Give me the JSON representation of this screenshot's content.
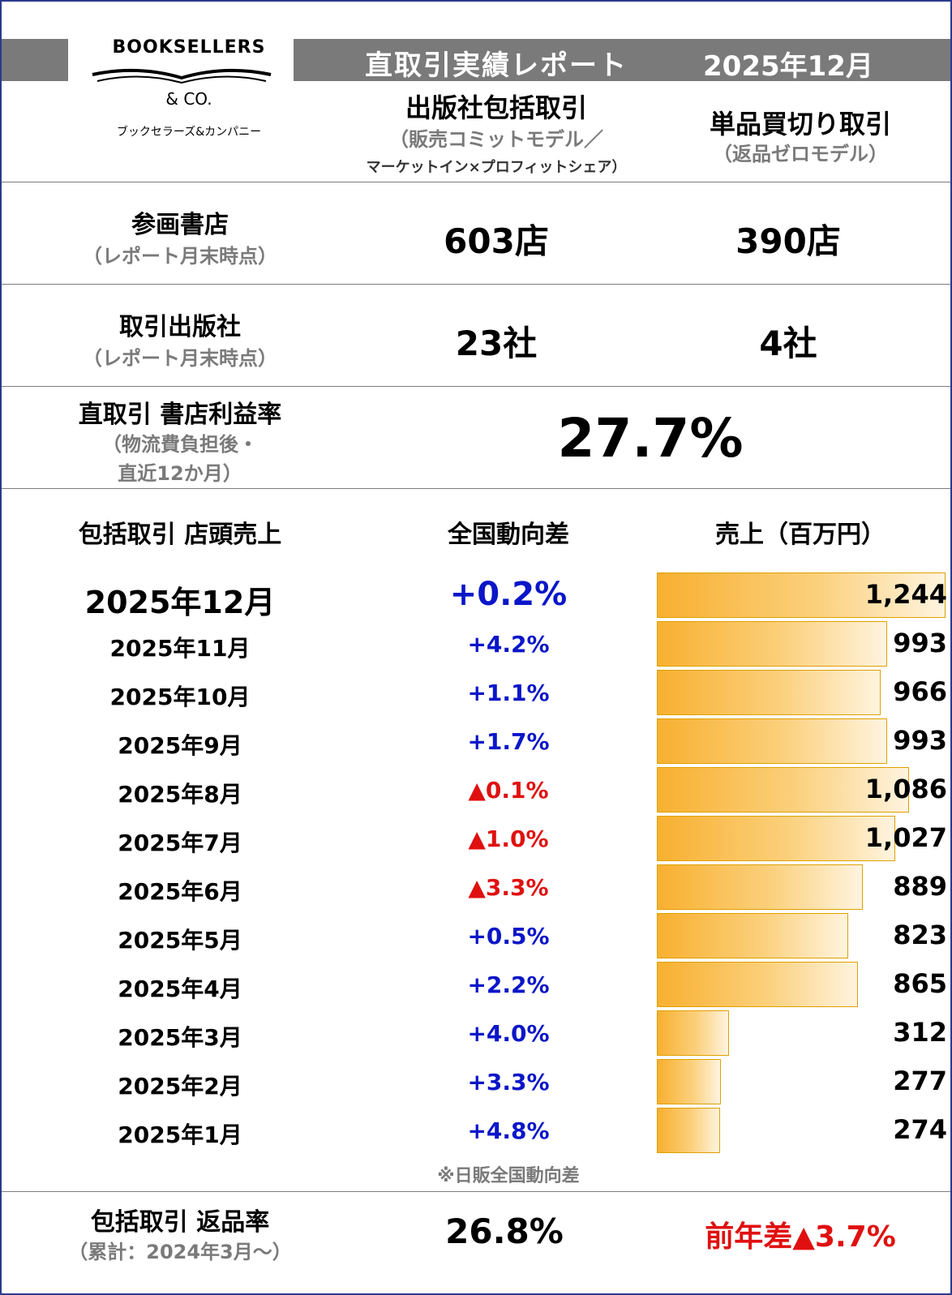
{
  "header": {
    "title": "直取引実績レポート",
    "period": "2025年12月"
  },
  "logo": {
    "name": "BOOKSELLERS",
    "co": "& CO.",
    "kana": "ブックセラーズ&カンパニー"
  },
  "columns": {
    "bundle": {
      "title": "出版社包括取引",
      "sub1": "（販売コミットモデル／",
      "sub2": "マーケットイン×プロフィットシェア）"
    },
    "single": {
      "title": "単品買切り取引",
      "sub": "（返品ゼロモデル）"
    }
  },
  "stores": {
    "label": "参画書店",
    "note": "（レポート月末時点）",
    "bundle": "603店",
    "single": "390店"
  },
  "publishers": {
    "label": "取引出版社",
    "note": "（レポート月末時点）",
    "bundle": "23社",
    "single": "4社"
  },
  "margin": {
    "label": "直取引 書店利益率",
    "note1": "（物流費負担後・",
    "note2": "直近12か月）",
    "value": "27.7%"
  },
  "sales_table": {
    "col_month": "包括取引 店頭売上",
    "col_diff": "全国動向差",
    "col_sales": "売上（百万円）",
    "footnote": "※日販全国動向差"
  },
  "chart_data": {
    "type": "bar",
    "orientation": "horizontal",
    "title": "売上（百万円）",
    "categories": [
      "2025年12月",
      "2025年11月",
      "2025年10月",
      "2025年9月",
      "2025年8月",
      "2025年7月",
      "2025年6月",
      "2025年5月",
      "2025年4月",
      "2025年3月",
      "2025年2月",
      "2025年1月"
    ],
    "values": [
      1244,
      993,
      966,
      993,
      1086,
      1027,
      889,
      823,
      865,
      312,
      277,
      274
    ],
    "value_labels": [
      "1,244",
      "993",
      "966",
      "993",
      "1,086",
      "1,027",
      "889",
      "823",
      "865",
      "312",
      "277",
      "274"
    ],
    "diff_labels": [
      "+0.2%",
      "+4.2%",
      "+1.1%",
      "+1.7%",
      "▲0.1%",
      "▲1.0%",
      "▲3.3%",
      "+0.5%",
      "+2.2%",
      "+4.0%",
      "+3.3%",
      "+4.8%"
    ],
    "diff_values": [
      0.2,
      4.2,
      1.1,
      1.7,
      -0.1,
      -1.0,
      -3.3,
      0.5,
      2.2,
      4.0,
      3.3,
      4.8
    ],
    "colors": {
      "positive": "#0a16c8",
      "negative": "#e01010",
      "bar_start": "#f8b030",
      "bar_end": "#fff4df"
    }
  },
  "returns": {
    "label": "包括取引 返品率",
    "note": "（累計：2024年3月～）",
    "value": "26.8%",
    "yoy": "前年差▲3.7%"
  }
}
